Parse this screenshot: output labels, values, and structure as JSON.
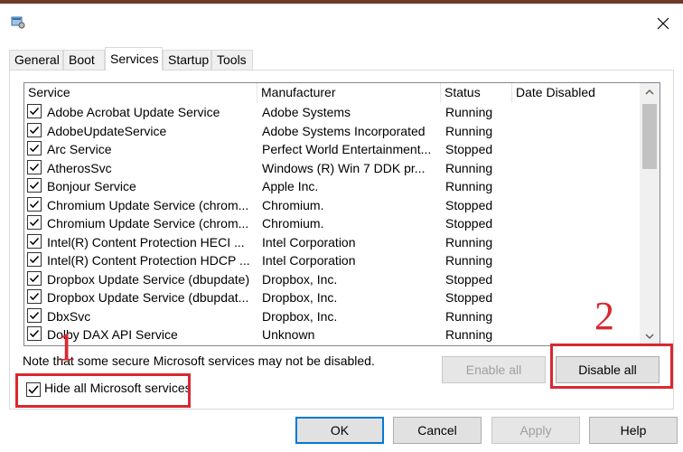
{
  "window": {
    "title": ""
  },
  "tabs": [
    {
      "label": "General"
    },
    {
      "label": "Boot"
    },
    {
      "label": "Services"
    },
    {
      "label": "Startup"
    },
    {
      "label": "Tools"
    }
  ],
  "active_tab": "Services",
  "columns": {
    "service": "Service",
    "manufacturer": "Manufacturer",
    "status": "Status",
    "date_disabled": "Date Disabled"
  },
  "services": [
    {
      "name": "Adobe Acrobat Update Service",
      "manufacturer": "Adobe Systems",
      "status": "Running",
      "date_disabled": "",
      "checked": true
    },
    {
      "name": "AdobeUpdateService",
      "manufacturer": "Adobe Systems Incorporated",
      "status": "Running",
      "date_disabled": "",
      "checked": true
    },
    {
      "name": "Arc Service",
      "manufacturer": "Perfect World Entertainment...",
      "status": "Stopped",
      "date_disabled": "",
      "checked": true
    },
    {
      "name": "AtherosSvc",
      "manufacturer": "Windows (R) Win 7 DDK pr...",
      "status": "Running",
      "date_disabled": "",
      "checked": true
    },
    {
      "name": "Bonjour Service",
      "manufacturer": "Apple Inc.",
      "status": "Running",
      "date_disabled": "",
      "checked": true
    },
    {
      "name": "Chromium Update Service (chrom...",
      "manufacturer": "Chromium.",
      "status": "Stopped",
      "date_disabled": "",
      "checked": true
    },
    {
      "name": "Chromium Update Service (chrom...",
      "manufacturer": "Chromium.",
      "status": "Stopped",
      "date_disabled": "",
      "checked": true
    },
    {
      "name": "Intel(R) Content Protection HECI ...",
      "manufacturer": "Intel Corporation",
      "status": "Running",
      "date_disabled": "",
      "checked": true
    },
    {
      "name": "Intel(R) Content Protection HDCP ...",
      "manufacturer": "Intel Corporation",
      "status": "Running",
      "date_disabled": "",
      "checked": true
    },
    {
      "name": "Dropbox Update Service (dbupdate)",
      "manufacturer": "Dropbox, Inc.",
      "status": "Stopped",
      "date_disabled": "",
      "checked": true
    },
    {
      "name": "Dropbox Update Service (dbupdat...",
      "manufacturer": "Dropbox, Inc.",
      "status": "Stopped",
      "date_disabled": "",
      "checked": true
    },
    {
      "name": "DbxSvc",
      "manufacturer": "Dropbox, Inc.",
      "status": "Running",
      "date_disabled": "",
      "checked": true
    },
    {
      "name": "Dolby DAX API Service",
      "manufacturer": "Unknown",
      "status": "Running",
      "date_disabled": "",
      "checked": true
    }
  ],
  "note": "Note that some secure Microsoft services may not be disabled.",
  "buttons": {
    "enable_all": "Enable all",
    "disable_all": "Disable all",
    "ok": "OK",
    "cancel": "Cancel",
    "apply": "Apply",
    "help": "Help"
  },
  "hide_microsoft": {
    "label": "Hide all Microsoft services",
    "checked": true
  },
  "annotations": {
    "marker_1": "1",
    "marker_2": "2"
  },
  "colors": {
    "annotation_red": "#d9282f",
    "title_strip": "#6b3a28",
    "default_button_border": "#0078d7"
  }
}
